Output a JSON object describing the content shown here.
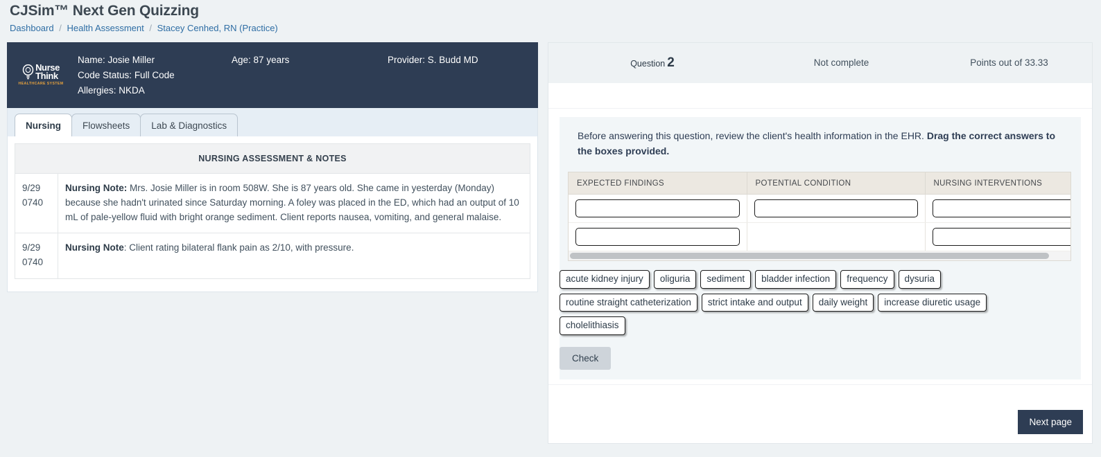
{
  "header": {
    "app_title": "CJSim™ Next Gen Quizzing",
    "breadcrumb": [
      {
        "label": "Dashboard"
      },
      {
        "label": "Health Assessment"
      },
      {
        "label": "Stacey Cenhed, RN (Practice)"
      }
    ],
    "breadcrumb_separator": "/"
  },
  "patient_banner": {
    "logo": {
      "word1": "Nurse",
      "word2": "Think",
      "subtitle": "HEALTHCARE SYSTEM",
      "icon": "lightbulb-icon"
    },
    "name_label": "Name:",
    "name_value": "Josie Miller",
    "age_label": "Age:",
    "age_value": "87 years",
    "provider_label": "Provider:",
    "provider_value": "S. Budd MD",
    "code_status_label": "Code Status:",
    "code_status_value": "Full Code",
    "allergies_label": "Allergies:",
    "allergies_value": "NKDA",
    "background_color": "#2e3d54"
  },
  "ehr_tabs": [
    {
      "label": "Nursing",
      "active": true
    },
    {
      "label": "Flowsheets",
      "active": false
    },
    {
      "label": "Lab & Diagnostics",
      "active": false
    }
  ],
  "notes": {
    "table_header": "NURSING ASSESSMENT & NOTES",
    "rows": [
      {
        "date": "9/29",
        "time": "0740",
        "label": "Nursing Note:",
        "text": " Mrs. Josie Miller is in room 508W. She is 87 years old. She came in yesterday (Monday) because she hadn't urinated since Saturday morning. A foley was placed in the ED, which had an output of 10 mL of pale-yellow fluid with bright orange sediment. Client reports nausea, vomiting, and general malaise."
      },
      {
        "date": "9/29",
        "time": "0740",
        "label": "Nursing Note",
        "text": ": Client rating bilateral flank pain as 2/10, with pressure."
      }
    ]
  },
  "question": {
    "number_label": "Question",
    "number": "2",
    "state": "Not complete",
    "points": "Points out of 33.33",
    "prompt_plain": "Before answering this question, review the client's health information in the EHR. ",
    "prompt_bold": "Drag the correct answers to the boxes provided.",
    "drag_table": {
      "columns": [
        "EXPECTED FINDINGS",
        "POTENTIAL CONDITION",
        "NURSING INTERVENTIONS"
      ],
      "rows": [
        {
          "cells": [
            {
              "has_slot": true
            },
            {
              "has_slot": true
            },
            {
              "has_slot": true
            }
          ]
        },
        {
          "cells": [
            {
              "has_slot": true
            },
            {
              "has_slot": false
            },
            {
              "has_slot": true
            }
          ]
        }
      ],
      "horizontal_scroll": true
    },
    "chips": [
      "acute kidney injury",
      "oliguria",
      "sediment",
      "bladder infection",
      "frequency",
      "dysuria",
      "routine straight catheterization",
      "strict intake and output",
      "daily weight",
      "increase diuretic usage",
      "cholelithiasis"
    ],
    "check_label": "Check",
    "next_page_label": "Next page"
  },
  "colors": {
    "page_background": "#eef2f4",
    "banner": "#2e3d54",
    "link": "#2e6da4",
    "tab_region": "#e6eef5",
    "prompt_panel": "#f2f6f8",
    "drag_header": "#ece8e1",
    "check_button": "#ced4da",
    "next_button": "#2e3d54",
    "logo_accent": "#e8a33d"
  }
}
